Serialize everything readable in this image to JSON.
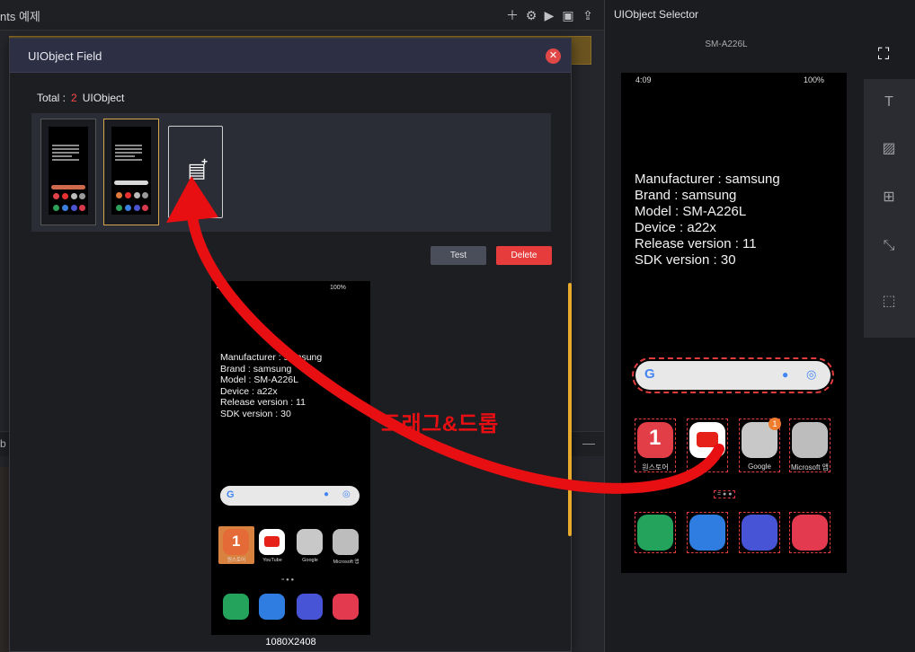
{
  "left": {
    "title": "nts 예제",
    "side_letter": "b"
  },
  "dialog": {
    "title": "UIObject Field",
    "close": "✕",
    "total_label": "Total :",
    "total_count": "2",
    "total_unit": "UIObject",
    "add_icon": "note-add-icon",
    "test_label": "Test",
    "delete_label": "Delete",
    "resolution": "1080X2408"
  },
  "preview": {
    "status_time": "4:09",
    "status_right": "100%",
    "info": "Manufacturer : samsung\nBrand : samsung\nModel : SM-A226L\nDevice : a22x\nRelease version : 11\nSDK version : 30",
    "apps_row1": [
      "원스토어",
      "YouTube",
      "Google",
      "Microsoft 앱"
    ]
  },
  "right_panel": {
    "title": "UIObject Selector",
    "device_model": "SM-A226L",
    "status_time": "4:09",
    "status_right": "100%",
    "info": "Manufacturer : samsung\nBrand : samsung\nModel : SM-A226L\nDevice : a22x\nRelease version : 11\nSDK version : 30",
    "apps_row1": [
      "원스토어",
      "YouTube",
      "Google",
      "Microsoft 앱"
    ],
    "badge": "1"
  },
  "annotation": {
    "drag_label": "드래그&드롭"
  },
  "colors": {
    "accent_red": "#e63c3c",
    "selection_gold": "#d7a64a",
    "scrollbar": "#e7a92b",
    "dialog_header": "#2d2f45"
  }
}
